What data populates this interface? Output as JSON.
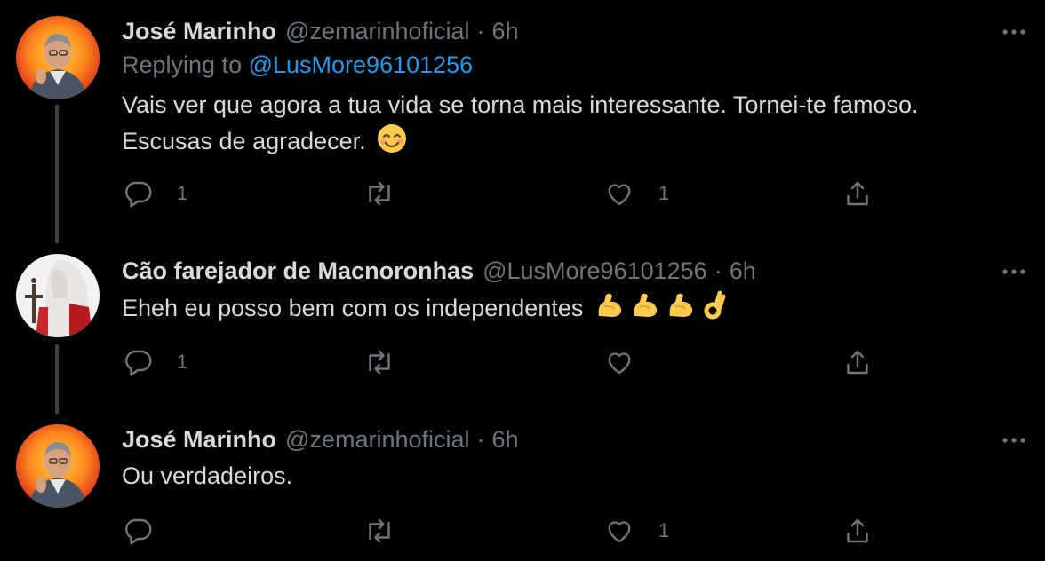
{
  "tweets": [
    {
      "name": "José Marinho",
      "handle": "@zemarinhoficial",
      "separator": "·",
      "time": "6h",
      "replying_prefix": "Replying to ",
      "replying_to": "@LusMore96101256",
      "text": "Vais ver que agora a tua vida se torna mais interessante. Tornei-te famoso. Escusas de agradecer.",
      "emoji": [
        "smiling-face-with-smiling-eyes"
      ],
      "replies": "1",
      "retweets": "",
      "likes": "1"
    },
    {
      "name": "Cão farejador de Macnoronhas",
      "handle": "@LusMore96101256",
      "separator": "·",
      "time": "6h",
      "text": "Eheh eu posso bem com os independentes",
      "emoji": [
        "flexed-biceps",
        "flexed-biceps",
        "flexed-biceps",
        "ok-hand"
      ],
      "replies": "1",
      "retweets": "",
      "likes": ""
    },
    {
      "name": "José Marinho",
      "handle": "@zemarinhoficial",
      "separator": "·",
      "time": "6h",
      "text": "Ou verdadeiros.",
      "emoji": [],
      "replies": "",
      "retweets": "",
      "likes": "1"
    }
  ],
  "colors": {
    "background": "#000000",
    "text": "#d9d9d9",
    "muted": "#6e767d",
    "link": "#1d9bf0",
    "thread_line": "#3d4145"
  },
  "icons": {
    "reply": "comment-bubble-icon",
    "retweet": "retweet-arrows-icon",
    "like": "heart-outline-icon",
    "share": "share-upload-icon",
    "more": "three-dots-icon"
  }
}
